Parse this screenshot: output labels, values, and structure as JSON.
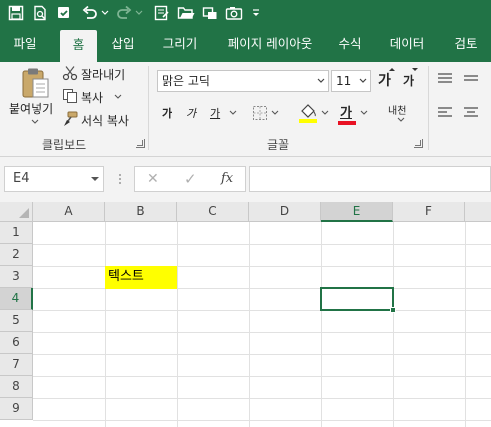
{
  "colors": {
    "brand": "#217346",
    "ribbon_bg": "#f3f3f3",
    "highlight_yellow": "#ffff00",
    "font_color_red": "#e81123"
  },
  "quick_access": {
    "icons": [
      "save-icon",
      "print-preview-icon",
      "spell-check-icon",
      "undo-icon",
      "undo-dropdown-icon",
      "redo-icon",
      "redo-dropdown-icon",
      "form-icon",
      "open-folder-icon",
      "screenshot-icon",
      "camera-icon",
      "customize-dropdown-icon"
    ]
  },
  "tabs": [
    "파일",
    "홈",
    "삽입",
    "그리기",
    "페이지 레이아웃",
    "수식",
    "데이터",
    "검토"
  ],
  "active_tab": "홈",
  "ribbon": {
    "clipboard": {
      "paste_label": "붙여넣기",
      "cut_label": "잘라내기",
      "copy_label": "복사",
      "format_painter_label": "서식 복사",
      "group_title": "클립보드"
    },
    "font": {
      "font_name": "맑은 고딕",
      "font_size": "11",
      "grow_label": "가",
      "shrink_label": "가",
      "bold_label": "가",
      "italic_label": "가",
      "underline_label": "가",
      "font_color_label": "가",
      "phonetic_label": "내천",
      "group_title": "글꼴"
    }
  },
  "formula_bar": {
    "name_box": "E4",
    "cancel_symbol": "✕",
    "enter_symbol": "✓",
    "fx_symbol": "fx",
    "formula": ""
  },
  "sheet": {
    "columns": [
      "A",
      "B",
      "C",
      "D",
      "E",
      "F"
    ],
    "rows": [
      "1",
      "2",
      "3",
      "4",
      "5",
      "6",
      "7",
      "8",
      "9"
    ],
    "selected_cell": "E4",
    "cells": {
      "B3": "텍스트"
    }
  }
}
